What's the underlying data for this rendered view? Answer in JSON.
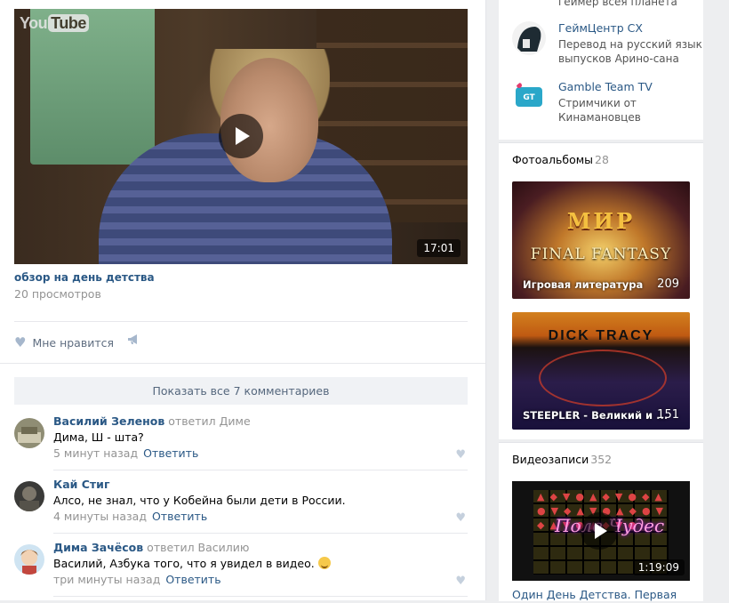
{
  "video": {
    "logo_you": "You",
    "logo_tube": "Tube",
    "duration": "17:01",
    "title": "обзор на день детства",
    "views": "20 просмотров"
  },
  "actions": {
    "like_label": "Мне нравится"
  },
  "comments": {
    "show_all": "Показать все 7 комментариев",
    "items": [
      {
        "author": "Василий Зеленов",
        "reply_to": "ответил Диме",
        "text": "Дима, Ш - шта?",
        "time": "5 минут назад",
        "reply": "Ответить"
      },
      {
        "author": "Кай Стиг",
        "reply_to": "",
        "text": "Алсо, не знал, что у Кобейна были дети в России.",
        "time": "4 минуты назад",
        "reply": "Ответить"
      },
      {
        "author": "Дима Зачёсов",
        "reply_to": "ответил Василию",
        "text": "Василий, Азбука того, что я увидел в видео.",
        "time": "три минуты назад",
        "reply": "Ответить"
      }
    ]
  },
  "sidebar": {
    "top_cut_text": "геймер всея планета",
    "groups": [
      {
        "name": "ГеймЦентр СХ",
        "desc": "Перевод на русский язык выпусков Арино-сана"
      },
      {
        "name": "Gamble Team TV",
        "desc": "Стримчики от Кинамановцев"
      }
    ],
    "albums_title": "Фотоальбомы",
    "albums_count": "28",
    "albums": [
      {
        "label": "Игровая литература",
        "count": "209",
        "art_text_1": "МИР",
        "art_text_2": "FINAL FANTASY"
      },
      {
        "label": "STEEPLER - Великий и ...",
        "count": "151",
        "art_text": "DICK TRACY"
      }
    ],
    "videos_title": "Видеозаписи",
    "videos_count": "352",
    "video_duration": "1:19:09",
    "video_caption": "Один День Детства. Первая",
    "video_thumb_text": "Поле Чудес"
  }
}
